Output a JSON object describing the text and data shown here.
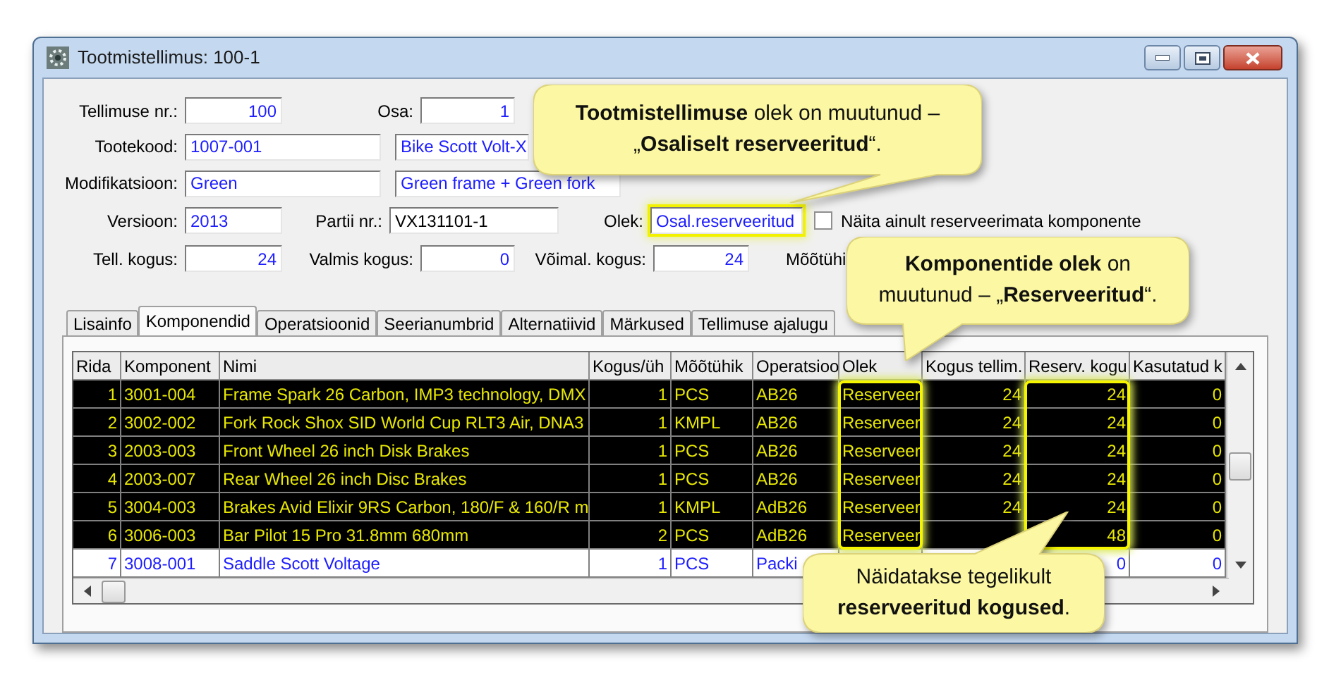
{
  "window": {
    "title": "Tootmistellimus: 100-1"
  },
  "form": {
    "order_no": {
      "label": "Tellimuse nr.:",
      "value": "100"
    },
    "part": {
      "label": "Osa:",
      "value": "1"
    },
    "product_code": {
      "label": "Tootekood:",
      "value": "1007-001",
      "description": "Bike Scott Volt-X"
    },
    "modification": {
      "label": "Modifikatsioon:",
      "value": "Green",
      "description": "Green frame + Green fork"
    },
    "version": {
      "label": "Versioon:",
      "value": "2013"
    },
    "batch": {
      "label": "Partii nr.:",
      "value": "VX131101-1"
    },
    "status": {
      "label": "Olek:",
      "value": "Osal.reserveeritud",
      "outlined": true
    },
    "unreserved_only": {
      "label": "Näita ainult reserveerimata komponente",
      "checked": false
    },
    "ordered_qty": {
      "label": "Tell. kogus:",
      "value": "24"
    },
    "done_qty": {
      "label": "Valmis kogus:",
      "value": "0"
    },
    "possible_qty": {
      "label": "Võimal. kogus:",
      "value": "24"
    },
    "unit_label": "Mõõtühi"
  },
  "tabs": [
    {
      "label": "Lisainfo",
      "selected": false
    },
    {
      "label": "Komponendid",
      "selected": true
    },
    {
      "label": "Operatsioonid",
      "selected": false
    },
    {
      "label": "Seerianumbrid",
      "selected": false
    },
    {
      "label": "Alternatiivid",
      "selected": false
    },
    {
      "label": "Märkused",
      "selected": false
    },
    {
      "label": "Tellimuse ajalugu",
      "selected": false
    }
  ],
  "table": {
    "columns": [
      {
        "label": "Rida",
        "outlined": false
      },
      {
        "label": "Komponent",
        "outlined": false
      },
      {
        "label": "Nimi",
        "outlined": false
      },
      {
        "label": "Kogus/üh",
        "outlined": false
      },
      {
        "label": "Mõõtühik",
        "outlined": false
      },
      {
        "label": "Operatsioo",
        "outlined": false
      },
      {
        "label": "Olek",
        "outlined": true
      },
      {
        "label": "Kogus tellim.",
        "outlined": false
      },
      {
        "label": "Reserv. kogu",
        "outlined": true
      },
      {
        "label": "Kasutatud k",
        "outlined": false
      }
    ],
    "rows": [
      {
        "reserved": true,
        "cells": [
          "1",
          "3001-004",
          "Frame Spark 26 Carbon, IMP3 technology, DMX",
          "1",
          "PCS",
          "AB26",
          "Reserveer",
          "24",
          "24",
          "0"
        ]
      },
      {
        "reserved": true,
        "cells": [
          "2",
          "3002-002",
          "Fork Rock Shox SID World Cup RLT3 Air, DNA3",
          "1",
          "KMPL",
          "AB26",
          "Reserveer",
          "24",
          "24",
          "0"
        ]
      },
      {
        "reserved": true,
        "cells": [
          "3",
          "2003-003",
          "Front Wheel 26 inch Disk Brakes",
          "1",
          "PCS",
          "AB26",
          "Reserveer",
          "24",
          "24",
          "0"
        ]
      },
      {
        "reserved": true,
        "cells": [
          "4",
          "2003-007",
          "Rear Wheel 26 inch Disc Brakes",
          "1",
          "PCS",
          "AB26",
          "Reserveer",
          "24",
          "24",
          "0"
        ]
      },
      {
        "reserved": true,
        "cells": [
          "5",
          "3004-003",
          "Brakes Avid Elixir 9RS Carbon, 180/F & 160/R m",
          "1",
          "KMPL",
          "AdB26",
          "Reserveer",
          "24",
          "24",
          "0"
        ]
      },
      {
        "reserved": true,
        "cells": [
          "6",
          "3006-003",
          "Bar Pilot 15 Pro 31.8mm 680mm",
          "2",
          "PCS",
          "AdB26",
          "Reserveer",
          null,
          "48",
          "0"
        ]
      },
      {
        "reserved": false,
        "cells": [
          "7",
          "3008-001",
          "Saddle Scott Voltage",
          "1",
          "PCS",
          "Packi",
          null,
          null,
          "0",
          "0"
        ]
      }
    ]
  },
  "callouts": [
    {
      "text": "**Tootmistellimuse** olek on muutunud  –\n„**Osaliselt reserveeritud**“."
    },
    {
      "text": "**Komponentide olek** on\nmuutunud  – „**Reserveeritud**“."
    },
    {
      "text": "Näidatakse tegelikult\n**reserveeritud kogused**."
    }
  ]
}
